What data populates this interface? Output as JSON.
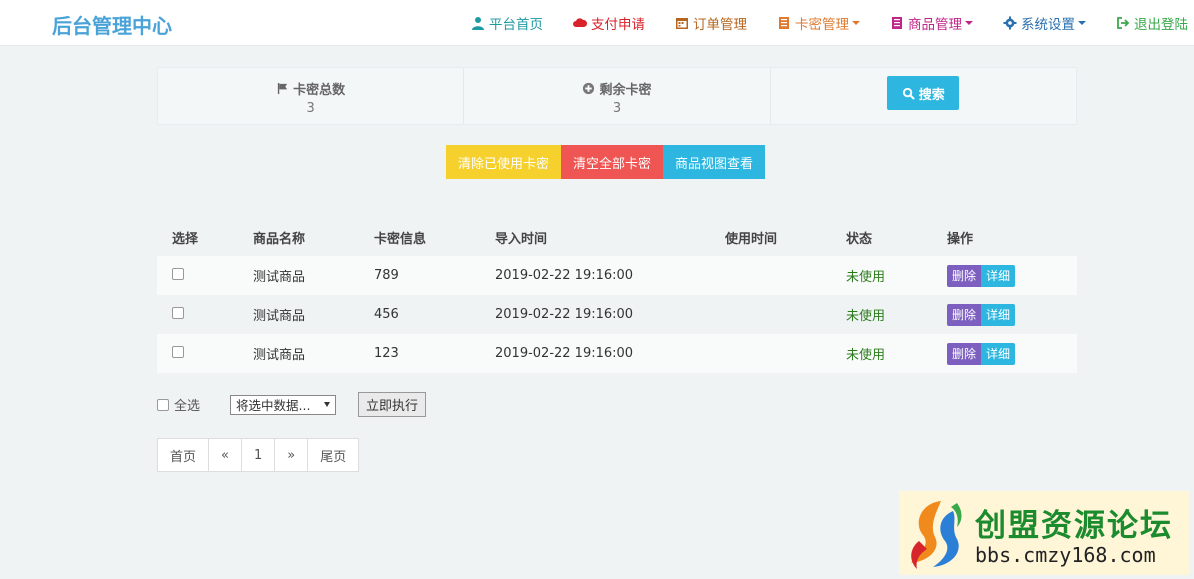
{
  "navbar": {
    "brand": "后台管理中心",
    "items": [
      {
        "label": "平台首页",
        "icon": "user-icon",
        "color": "#1e9aa3"
      },
      {
        "label": "支付申请",
        "icon": "cloud-icon",
        "color": "#d9232a"
      },
      {
        "label": "订单管理",
        "icon": "calendar-icon",
        "color": "#b5651d"
      },
      {
        "label": "卡密管理",
        "icon": "book-icon",
        "color": "#e07a2f",
        "dropdown": true
      },
      {
        "label": "商品管理",
        "icon": "book-icon",
        "color": "#c0258a",
        "dropdown": true
      },
      {
        "label": "系统设置",
        "icon": "gear-icon",
        "color": "#2a6fb0",
        "dropdown": true
      },
      {
        "label": "退出登陆",
        "icon": "logout-icon",
        "color": "#3aa94b"
      }
    ]
  },
  "stats": {
    "total_label": "卡密总数",
    "total_value": "3",
    "remaining_label": "剩余卡密",
    "remaining_value": "3",
    "search_label": "搜索"
  },
  "actions": [
    {
      "label": "清除已使用卡密",
      "color": "#f6d12d"
    },
    {
      "label": "清空全部卡密",
      "color": "#ef5552"
    },
    {
      "label": "商品视图查看",
      "color": "#2db7e0"
    }
  ],
  "table": {
    "headers": [
      "选择",
      "商品名称",
      "卡密信息",
      "导入时间",
      "使用时间",
      "状态",
      "操作"
    ],
    "rows": [
      {
        "name": "测试商品",
        "card": "789",
        "import_time": "2019-02-22 19:16:00",
        "use_time": "",
        "status": "未使用"
      },
      {
        "name": "测试商品",
        "card": "456",
        "import_time": "2019-02-22 19:16:00",
        "use_time": "",
        "status": "未使用"
      },
      {
        "name": "测试商品",
        "card": "123",
        "import_time": "2019-02-22 19:16:00",
        "use_time": "",
        "status": "未使用"
      }
    ],
    "delete_label": "删除",
    "detail_label": "详细"
  },
  "bulk": {
    "select_all_label": "全选",
    "select_value": "将选中数据...",
    "execute_label": "立即执行"
  },
  "pagination": {
    "first": "首页",
    "prev": "«",
    "current": "1",
    "next": "»",
    "last": "尾页"
  },
  "watermark": {
    "title": "创盟资源论坛",
    "url": "bbs.cmzy168.com"
  }
}
